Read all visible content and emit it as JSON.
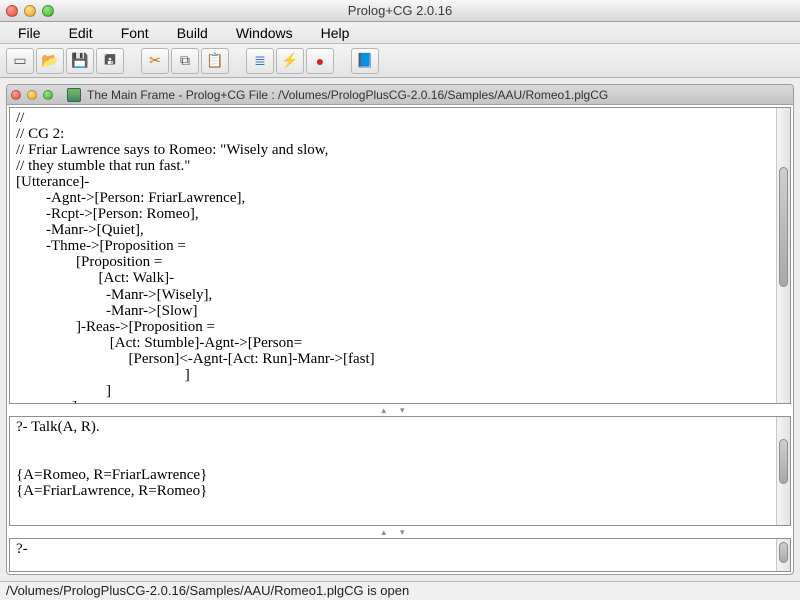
{
  "window": {
    "title": "Prolog+CG 2.0.16"
  },
  "menu": {
    "file": "File",
    "edit": "Edit",
    "font": "Font",
    "build": "Build",
    "windows": "Windows",
    "help": "Help"
  },
  "inner": {
    "title": "The Main Frame - Prolog+CG File : /Volumes/PrologPlusCG-2.0.16/Samples/AAU/Romeo1.plgCG"
  },
  "editor": {
    "content": "//\n// CG 2:\n// Friar Lawrence says to Romeo: \"Wisely and slow,\n// they stumble that run fast.\"\n[Utterance]-\n        -Agnt->[Person: FriarLawrence],\n        -Rcpt->[Person: Romeo],\n        -Manr->[Quiet],\n        -Thme->[Proposition =\n                [Proposition =\n                      [Act: Walk]-\n                        -Manr->[Wisely],\n                        -Manr->[Slow]\n                ]-Reas->[Proposition =\n                         [Act: Stumble]-Agnt->[Person=\n                              [Person]<-Agnt-[Act: Run]-Manr->[fast]\n                                             ]\n                        ]\n               ]"
  },
  "console": {
    "content": "?- Talk(A, R).\n\n\n{A=Romeo, R=FriarLawrence}\n{A=FriarLawrence, R=Romeo}"
  },
  "prompt": {
    "content": "?-"
  },
  "status": {
    "text": "/Volumes/PrologPlusCG-2.0.16/Samples/AAU/Romeo1.plgCG is open"
  }
}
